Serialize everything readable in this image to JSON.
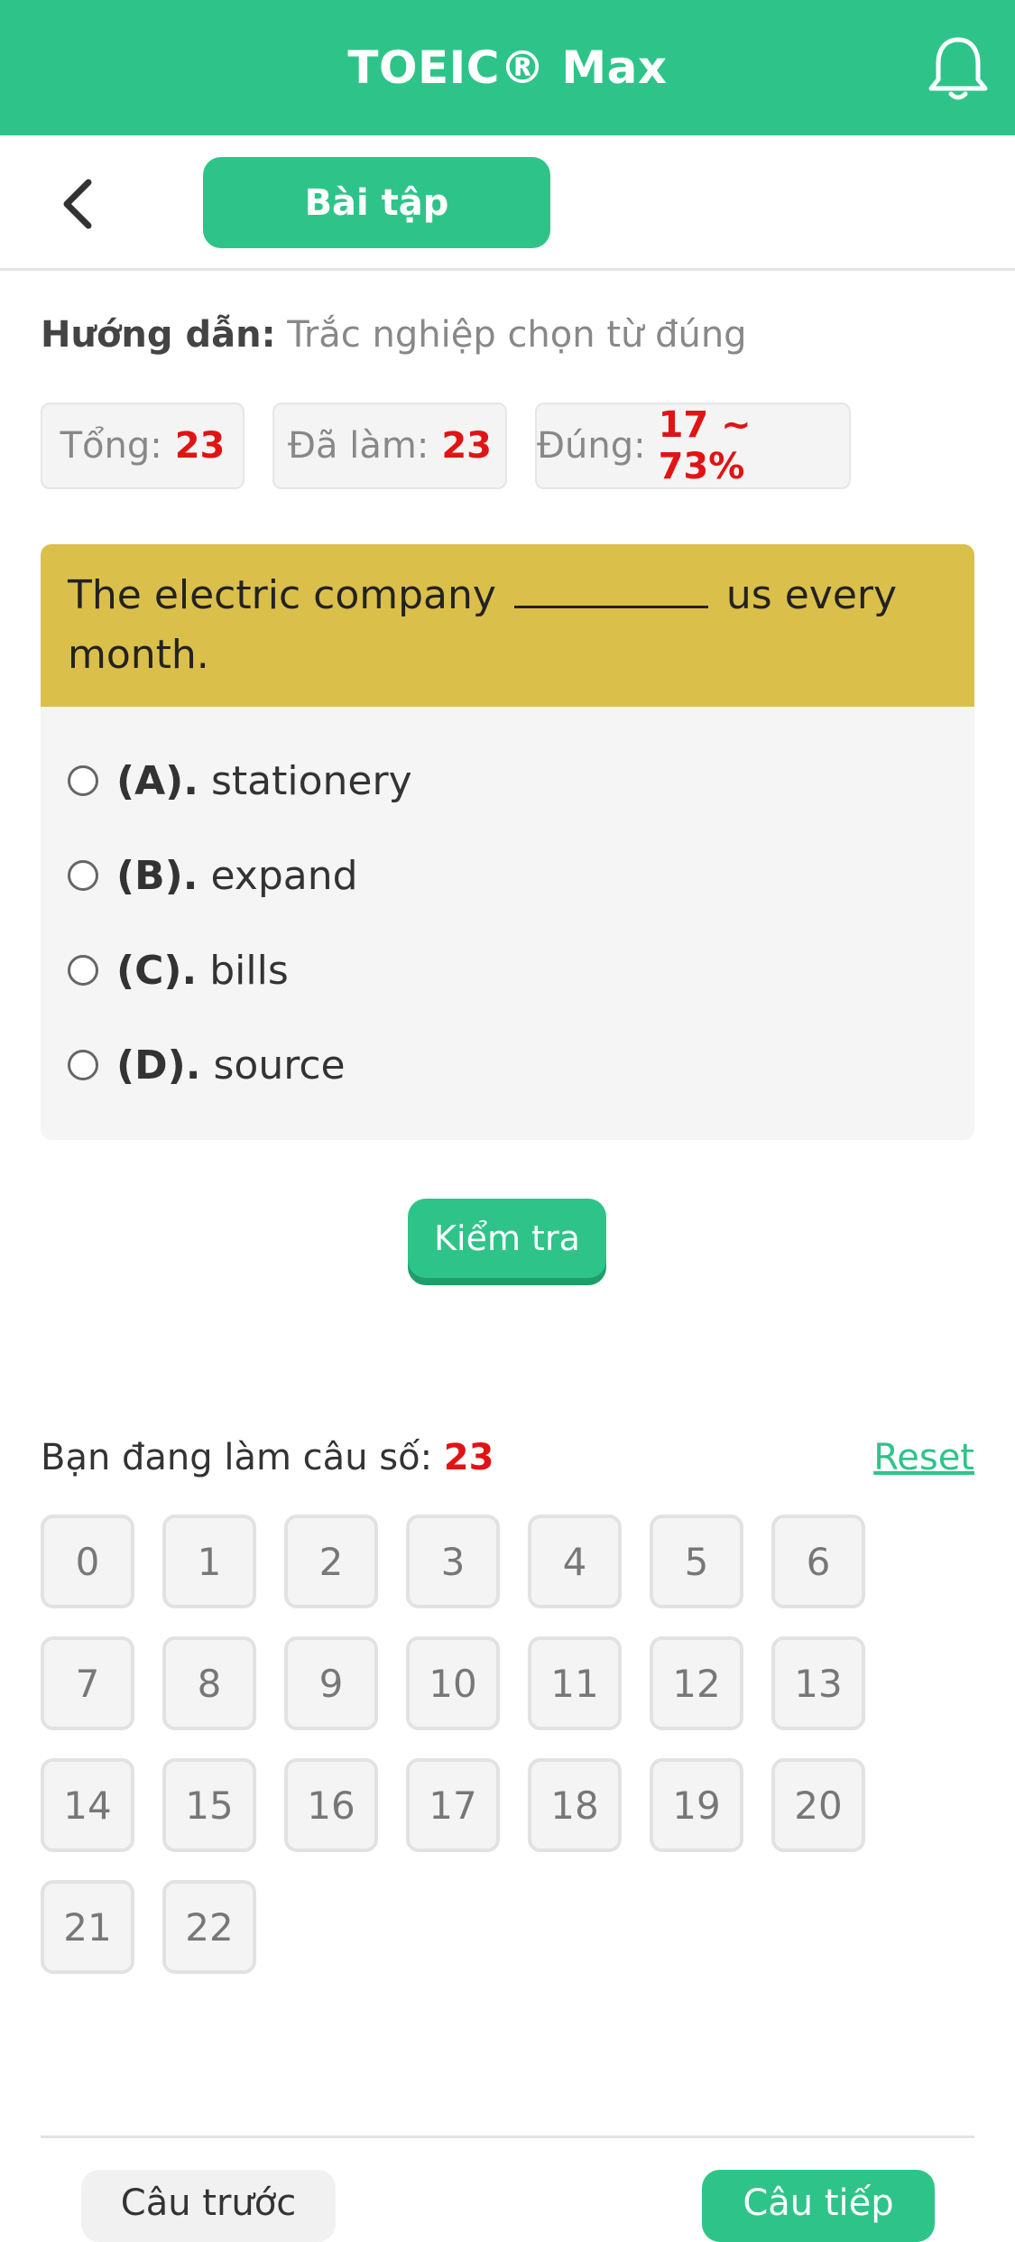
{
  "header": {
    "title": "TOEIC® Max",
    "icon": "bell-icon"
  },
  "subheader": {
    "back_icon": "chevron-left-icon",
    "tab_label": "Bài tập"
  },
  "instruction": {
    "label": "Hướng dẫn:",
    "value": "Trắc nghiệp chọn từ đúng"
  },
  "stats": {
    "total_label": "Tổng:",
    "total_value": "23",
    "done_label": "Đã làm:",
    "done_value": "23",
    "correct_label": "Đúng:",
    "correct_value": "17 ~ 73%"
  },
  "question": {
    "text_before": "The electric company",
    "text_after": "us every",
    "text_line2": "month.",
    "options": [
      {
        "letter": "(A).",
        "text": "stationery"
      },
      {
        "letter": "(B).",
        "text": "expand"
      },
      {
        "letter": "(C).",
        "text": "bills"
      },
      {
        "letter": "(D).",
        "text": "source"
      }
    ]
  },
  "check_button": "Kiểm tra",
  "progress": {
    "label": "Bạn đang làm câu số:",
    "current": "23",
    "reset": "Reset"
  },
  "grid": [
    "0",
    "1",
    "2",
    "3",
    "4",
    "5",
    "6",
    "7",
    "8",
    "9",
    "10",
    "11",
    "12",
    "13",
    "14",
    "15",
    "16",
    "17",
    "18",
    "19",
    "20",
    "21",
    "22"
  ],
  "footer": {
    "prev_label": "Câu trước",
    "next_label": "Câu tiếp"
  },
  "colors": {
    "brand": "#2ec489",
    "question_header": "#dbbf4b",
    "highlight": "#e01414"
  }
}
